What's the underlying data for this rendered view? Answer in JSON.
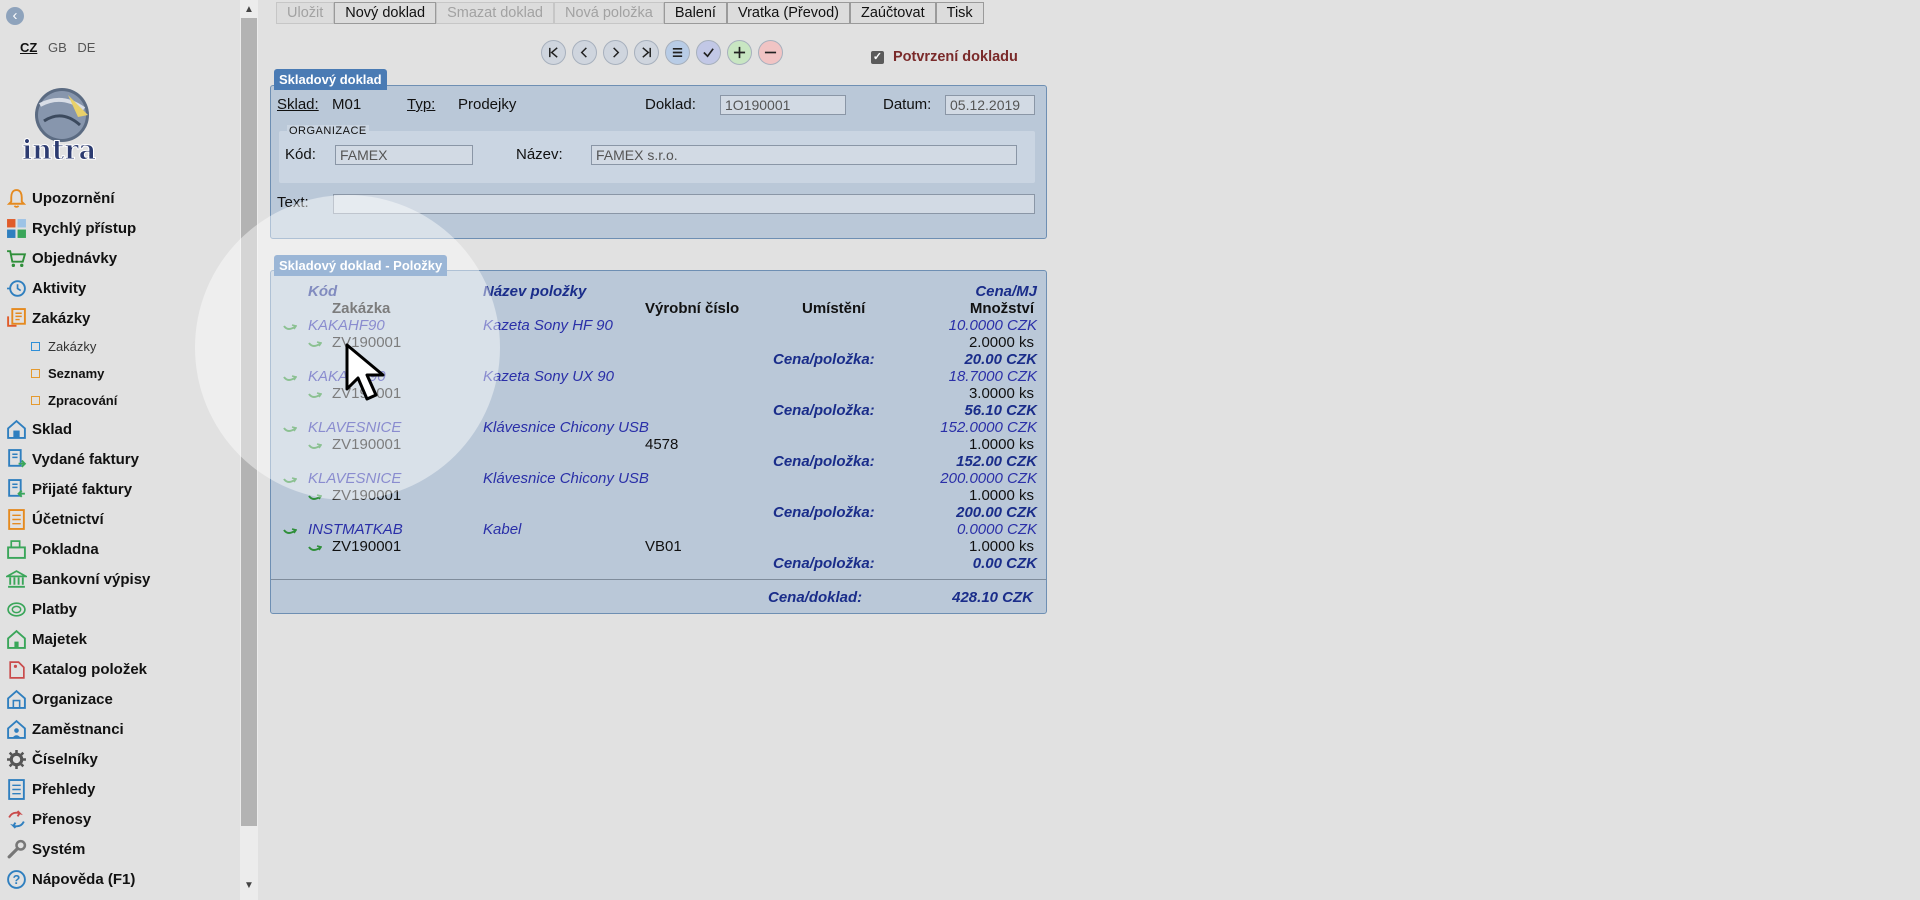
{
  "languages": [
    "CZ",
    "GB",
    "DE"
  ],
  "logo_text": "intra",
  "menu": [
    {
      "label": "Upozornění",
      "icon": "bell-icon"
    },
    {
      "label": "Rychlý přístup",
      "icon": "quick-access-icon"
    },
    {
      "label": "Objednávky",
      "icon": "cart-icon"
    },
    {
      "label": "Aktivity",
      "icon": "clock-icon"
    },
    {
      "label": "Zakázky",
      "icon": "order-icon"
    }
  ],
  "submenu": [
    {
      "label": "Zakázky"
    },
    {
      "label": "Seznamy"
    },
    {
      "label": "Zpracování"
    }
  ],
  "menu2": [
    {
      "label": "Sklad",
      "icon": "warehouse-icon"
    },
    {
      "label": "Vydané faktury",
      "icon": "invoice-out-icon"
    },
    {
      "label": "Přijaté faktury",
      "icon": "invoice-in-icon"
    },
    {
      "label": "Účetnictví",
      "icon": "ledger-icon"
    },
    {
      "label": "Pokladna",
      "icon": "cash-register-icon"
    },
    {
      "label": "Bankovní výpisy",
      "icon": "bank-icon"
    },
    {
      "label": "Platby",
      "icon": "payment-icon"
    },
    {
      "label": "Majetek",
      "icon": "assets-icon"
    },
    {
      "label": "Katalog položek",
      "icon": "catalog-icon"
    },
    {
      "label": "Organizace",
      "icon": "organization-icon"
    },
    {
      "label": "Zaměstnanci",
      "icon": "employees-icon"
    },
    {
      "label": "Číselníky",
      "icon": "gear-icon"
    },
    {
      "label": "Přehledy",
      "icon": "overview-icon"
    },
    {
      "label": "Přenosy",
      "icon": "transfer-icon"
    },
    {
      "label": "Systém",
      "icon": "wrench-icon"
    },
    {
      "label": "Nápověda (F1)",
      "icon": "help-icon"
    }
  ],
  "toolbar": {
    "save": "Uložit",
    "new_doc": "Nový doklad",
    "delete_doc": "Smazat doklad",
    "new_item": "Nová položka",
    "packing": "Balení",
    "return": "Vratka (Převod)",
    "post": "Zaúčtovat",
    "print": "Tisk"
  },
  "confirm_label": "Potvrzení dokladu",
  "doc": {
    "title": "Skladový doklad",
    "warehouse_label": "Sklad:",
    "warehouse": "M01",
    "type_label": "Typ:",
    "type": "Prodejky",
    "doc_label": "Doklad:",
    "doc_no": "1O190001",
    "date_label": "Datum:",
    "date": "05.12.2019",
    "org_legend": "ORGANIZACE",
    "code_label": "Kód:",
    "org_code": "FAMEX",
    "name_label": "Název:",
    "org_name": "FAMEX s.r.o.",
    "text_label": "Text:",
    "text": ""
  },
  "items": {
    "title": "Skladový doklad - Položky",
    "headers": {
      "code": "Kód",
      "order": "Zakázka",
      "name": "Název položky",
      "serial": "Výrobní číslo",
      "location": "Umístění",
      "unit_price": "Cena/MJ",
      "qty": "Množství"
    },
    "line_total_label": "Cena/položka:",
    "rows": [
      {
        "code": "KAKAHF90",
        "order": "ZV190001",
        "name": "Kazeta Sony HF 90",
        "serial": "",
        "price": "10.0000 CZK",
        "qty": "2.0000 ks",
        "total": "20.00 CZK"
      },
      {
        "code": "KAKAUX90",
        "order": "ZV190001",
        "name": "Kazeta Sony UX 90",
        "serial": "",
        "price": "18.7000 CZK",
        "qty": "3.0000 ks",
        "total": "56.10 CZK"
      },
      {
        "code": "KLAVESNICE",
        "order": "ZV190001",
        "name": "Klávesnice Chicony USB",
        "serial": "4578",
        "price": "152.0000 CZK",
        "qty": "1.0000 ks",
        "total": "152.00 CZK"
      },
      {
        "code": "KLAVESNICE",
        "order": "ZV190001",
        "name": "Klávesnice Chicony USB",
        "serial": "",
        "price": "200.0000 CZK",
        "qty": "1.0000 ks",
        "total": "200.00 CZK"
      },
      {
        "code": "INSTMATKAB",
        "order": "ZV190001",
        "name": "Kabel",
        "serial": "VB01",
        "price": "0.0000 CZK",
        "qty": "1.0000 ks",
        "total": "0.00 CZK"
      }
    ],
    "doc_total_label": "Cena/doklad:",
    "doc_total": "428.10 CZK"
  }
}
